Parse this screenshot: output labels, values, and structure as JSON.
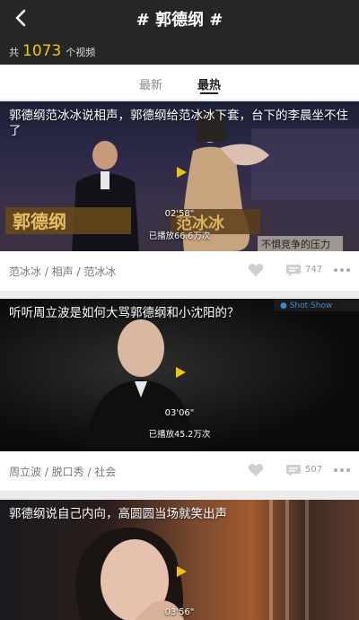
{
  "header": {
    "title": "# 郭德纲 #",
    "count_prefix": "共",
    "count_value": "1073",
    "count_suffix": "个视频"
  },
  "tabs": [
    {
      "label": "最新",
      "active": false
    },
    {
      "label": "最热",
      "active": true
    }
  ],
  "videos": [
    {
      "title": "郭德纲范冰冰说相声，郭德纲给范冰冰下套，台下的李晨坐不住了",
      "duration": "02'58\"",
      "views": "已播放66.6万次",
      "tags": "范冰冰 / 相声 / 范冰冰",
      "comments": "747"
    },
    {
      "title": "听听周立波是如何大骂郭德纲和小沈阳的？",
      "duration": "03'06\"",
      "views": "已播放45.2万次",
      "tags": "周立波 / 脱口秀 / 社会",
      "comments": "507"
    },
    {
      "title": "郭德纲说自己内向，高圆圆当场就笑出声",
      "duration": "03'56\"",
      "views": "",
      "tags": "",
      "comments": ""
    }
  ],
  "colors": {
    "header_bg": "#262626",
    "accent_count": "#f2c500",
    "play_icon": "#f2c500"
  }
}
